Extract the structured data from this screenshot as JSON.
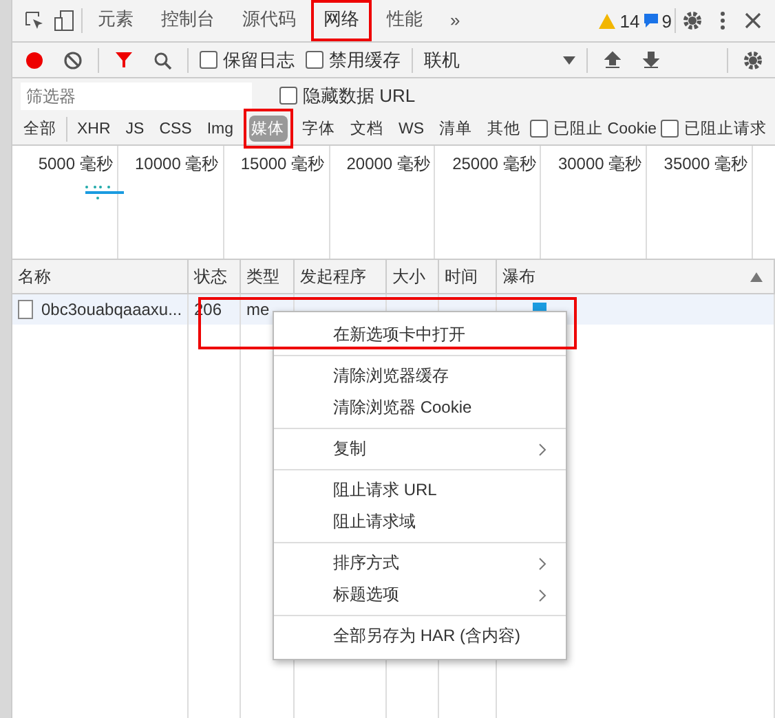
{
  "main_tabs": [
    {
      "label": "元素",
      "selected": false,
      "highlighted": false
    },
    {
      "label": "控制台",
      "selected": false,
      "highlighted": false
    },
    {
      "label": "源代码",
      "selected": false,
      "highlighted": false
    },
    {
      "label": "网络",
      "selected": true,
      "highlighted": true
    },
    {
      "label": "性能",
      "selected": false,
      "highlighted": false
    }
  ],
  "more_tabs": "»",
  "warnings": "14",
  "messages": "9",
  "toolbar": {
    "recording": true,
    "filter_active": true,
    "preserve_log": {
      "label": "保留日志",
      "checked": false
    },
    "disable_cache": {
      "label": "禁用缓存",
      "checked": false
    },
    "throttling": "联机"
  },
  "filter": {
    "placeholder": "筛选器",
    "hide_data_urls": {
      "label": "隐藏数据 URL",
      "checked": false
    }
  },
  "type_filters": [
    {
      "label": "全部",
      "selected": false,
      "highlighted": false
    },
    {
      "label": "XHR",
      "selected": false,
      "highlighted": false
    },
    {
      "label": "JS",
      "selected": false,
      "highlighted": false
    },
    {
      "label": "CSS",
      "selected": false,
      "highlighted": false
    },
    {
      "label": "Img",
      "selected": false,
      "highlighted": false
    },
    {
      "label": "媒体",
      "selected": true,
      "highlighted": true
    },
    {
      "label": "字体",
      "selected": false,
      "highlighted": false
    },
    {
      "label": "文档",
      "selected": false,
      "highlighted": false
    },
    {
      "label": "WS",
      "selected": false,
      "highlighted": false
    },
    {
      "label": "清单",
      "selected": false,
      "highlighted": false
    },
    {
      "label": "其他",
      "selected": false,
      "highlighted": false
    }
  ],
  "blocked_cookies": {
    "label": "已阻止 Cookie",
    "checked": false
  },
  "blocked_requests": {
    "label": "已阻止请求",
    "checked": false
  },
  "timeline_ticks": [
    "5000 毫秒",
    "10000 毫秒",
    "15000 毫秒",
    "20000 毫秒",
    "25000 毫秒",
    "30000 毫秒",
    "35000 毫秒"
  ],
  "table": {
    "columns": [
      "名称",
      "状态",
      "类型",
      "发起程序",
      "大小",
      "时间",
      "瀑布"
    ],
    "rows": [
      {
        "name": "0bc3ouabqaaaxu...",
        "status": "206",
        "type": "me"
      }
    ]
  },
  "context_menu": {
    "groups": [
      [
        {
          "label": "在新选项卡中打开",
          "submenu": false,
          "highlighted": true
        }
      ],
      [
        {
          "label": "清除浏览器缓存",
          "submenu": false,
          "highlighted": false
        },
        {
          "label": "清除浏览器 Cookie",
          "submenu": false,
          "highlighted": false
        }
      ],
      [
        {
          "label": "复制",
          "submenu": true,
          "highlighted": false
        }
      ],
      [
        {
          "label": "阻止请求 URL",
          "submenu": false,
          "highlighted": false
        },
        {
          "label": "阻止请求域",
          "submenu": false,
          "highlighted": false
        }
      ],
      [
        {
          "label": "排序方式",
          "submenu": true,
          "highlighted": false
        },
        {
          "label": "标题选项",
          "submenu": true,
          "highlighted": false
        }
      ],
      [
        {
          "label": "全部另存为 HAR (含内容)",
          "submenu": false,
          "highlighted": false
        }
      ]
    ]
  }
}
